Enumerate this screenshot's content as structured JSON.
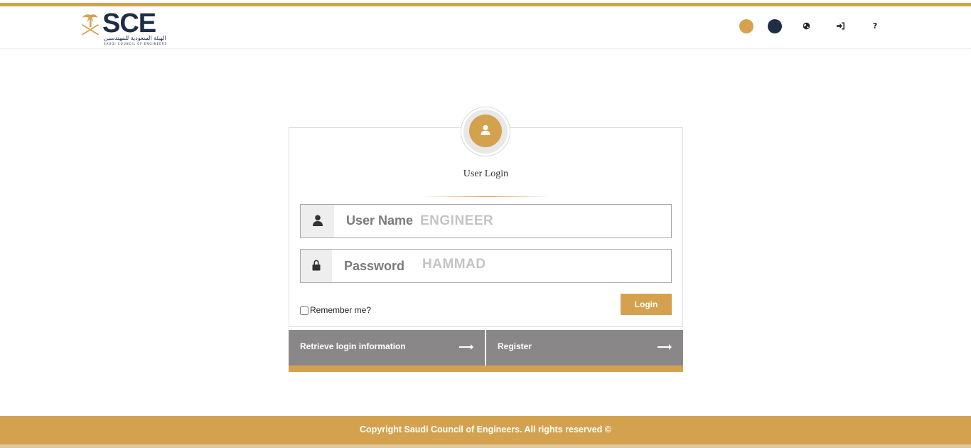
{
  "brand": {
    "logo_text": "SCE",
    "logo_subtitle_ar": "الهيئة السعودية للمهندسين",
    "logo_subtitle_en": "SAUDI COUNCIL OF ENGINEERS"
  },
  "header": {
    "theme_colors": [
      "#d4a24e",
      "#1f2d45"
    ],
    "icons": [
      "globe-icon",
      "sign-in-icon",
      "help-icon"
    ],
    "help_label": "?"
  },
  "login": {
    "title": "User Login",
    "username_label": "User Name",
    "username_value": "ENGINEER",
    "password_label": "Password",
    "password_value": "HAMMAD",
    "remember_label": "Remember me?",
    "login_button": "Login"
  },
  "links": {
    "retrieve": "Retrieve login information",
    "register": "Register"
  },
  "footer": {
    "copyright": "Copyright Saudi Council of Engineers. All rights reserved ©"
  },
  "colors": {
    "accent": "#d4a24e",
    "navy": "#1f2d45",
    "link_bar": "#8a8789"
  }
}
